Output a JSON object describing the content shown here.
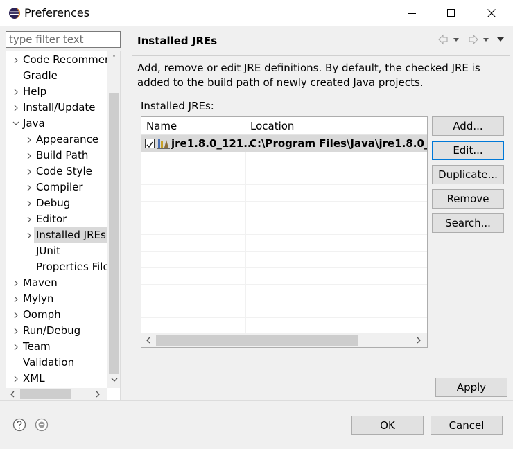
{
  "window": {
    "title": "Preferences",
    "icon": "eclipse-icon",
    "controls": [
      "minimize-icon",
      "maximize-icon",
      "close-icon"
    ]
  },
  "sidebar": {
    "filter_placeholder": "type filter text",
    "items": [
      {
        "label": "Code Recommenders",
        "level": 0,
        "expandable": true,
        "expanded": false
      },
      {
        "label": "Gradle",
        "level": 0,
        "expandable": false
      },
      {
        "label": "Help",
        "level": 0,
        "expandable": true,
        "expanded": false
      },
      {
        "label": "Install/Update",
        "level": 0,
        "expandable": true,
        "expanded": false
      },
      {
        "label": "Java",
        "level": 0,
        "expandable": true,
        "expanded": true
      },
      {
        "label": "Appearance",
        "level": 1,
        "expandable": true,
        "expanded": false
      },
      {
        "label": "Build Path",
        "level": 1,
        "expandable": true,
        "expanded": false
      },
      {
        "label": "Code Style",
        "level": 1,
        "expandable": true,
        "expanded": false
      },
      {
        "label": "Compiler",
        "level": 1,
        "expandable": true,
        "expanded": false
      },
      {
        "label": "Debug",
        "level": 1,
        "expandable": true,
        "expanded": false
      },
      {
        "label": "Editor",
        "level": 1,
        "expandable": true,
        "expanded": false
      },
      {
        "label": "Installed JREs",
        "level": 1,
        "expandable": true,
        "expanded": false,
        "selected": true
      },
      {
        "label": "JUnit",
        "level": 1,
        "expandable": false
      },
      {
        "label": "Properties Files Editor",
        "level": 1,
        "expandable": false
      },
      {
        "label": "Maven",
        "level": 0,
        "expandable": true,
        "expanded": false
      },
      {
        "label": "Mylyn",
        "level": 0,
        "expandable": true,
        "expanded": false
      },
      {
        "label": "Oomph",
        "level": 0,
        "expandable": true,
        "expanded": false
      },
      {
        "label": "Run/Debug",
        "level": 0,
        "expandable": true,
        "expanded": false
      },
      {
        "label": "Team",
        "level": 0,
        "expandable": true,
        "expanded": false
      },
      {
        "label": "Validation",
        "level": 0,
        "expandable": false
      },
      {
        "label": "XML",
        "level": 0,
        "expandable": true,
        "expanded": false
      }
    ]
  },
  "page": {
    "title": "Installed JREs",
    "nav_icons": [
      "back-arrow-icon",
      "dropdown-icon",
      "forward-arrow-icon",
      "dropdown-icon",
      "view-menu-icon"
    ],
    "description": "Add, remove or edit JRE definitions. By default, the checked JRE is added to the build path of newly created Java projects.",
    "table_label": "Installed JREs:",
    "columns": [
      "Name",
      "Location"
    ],
    "rows": [
      {
        "checked": true,
        "icon": "jre-library-icon",
        "name": "jre1.8.0_121...",
        "location": "C:\\Program Files\\Java\\jre1.8.0_..."
      }
    ],
    "buttons": {
      "add": "Add...",
      "edit": "Edit...",
      "duplicate": "Duplicate...",
      "remove": "Remove",
      "search": "Search..."
    },
    "apply": "Apply"
  },
  "footer": {
    "ok": "OK",
    "cancel": "Cancel",
    "icons": [
      "help-icon",
      "tip-icon"
    ]
  },
  "colors": {
    "accent": "#0078d7",
    "selection": "#d9d9d9",
    "button_bg": "#e1e1e1"
  }
}
